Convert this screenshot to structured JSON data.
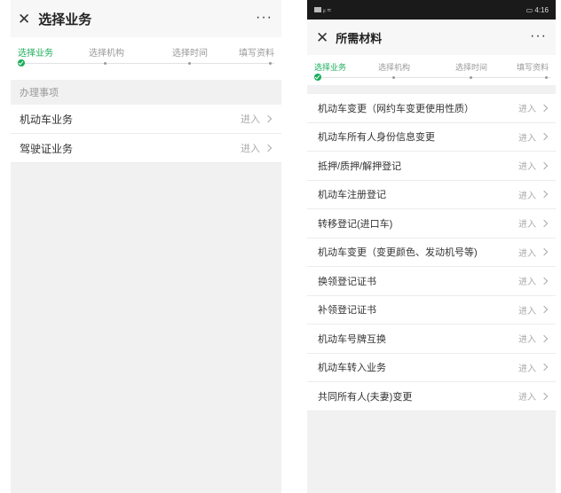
{
  "left": {
    "title": "选择业务",
    "close_icon": "close-icon",
    "more_icon": "more-icon",
    "steps": [
      "选择业务",
      "选择机构",
      "选择时间",
      "填写资料"
    ],
    "section_header": "办理事项",
    "items": [
      {
        "label": "机动车业务",
        "action": "进入"
      },
      {
        "label": "驾驶证业务",
        "action": "进入"
      }
    ]
  },
  "right": {
    "status_bar": {
      "time": "4:16"
    },
    "title": "所需材料",
    "steps": [
      "选择业务",
      "选择机构",
      "选择时间",
      "填写资料"
    ],
    "items": [
      {
        "label": "机动车变更（网约车变更使用性质）",
        "action": "进入"
      },
      {
        "label": "机动车所有人身份信息变更",
        "action": "进入"
      },
      {
        "label": "抵押/质押/解押登记",
        "action": "进入"
      },
      {
        "label": "机动车注册登记",
        "action": "进入"
      },
      {
        "label": "转移登记(进口车)",
        "action": "进入"
      },
      {
        "label": "机动车变更（变更颜色、发动机号等)",
        "action": "进入"
      },
      {
        "label": "换领登记证书",
        "action": "进入"
      },
      {
        "label": "补领登记证书",
        "action": "进入"
      },
      {
        "label": "机动车号牌互换",
        "action": "进入"
      },
      {
        "label": "机动车转入业务",
        "action": "进入"
      },
      {
        "label": "共同所有人(夫妻)变更",
        "action": "进入"
      }
    ]
  },
  "colors": {
    "accent": "#1aad5a",
    "background": "#f1f1f1"
  }
}
